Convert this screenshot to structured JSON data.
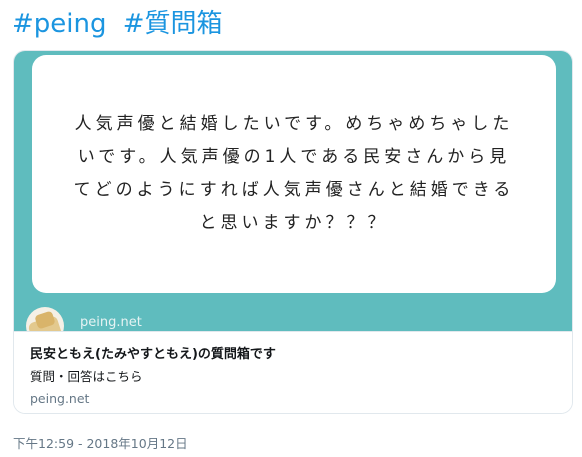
{
  "hashtags": [
    "#peing",
    "#質問箱"
  ],
  "card": {
    "question_lines": [
      "人気声優と結婚したいです。めちゃめちゃした",
      "いです。人気声優の1人である民安さんから見",
      "てどのようにすれば人気声優さんと結婚できる",
      "と思いますか？？？"
    ],
    "site_on_image": "peing.net",
    "title": "民安ともえ(たみやすともえ)の質問箱です",
    "description": "質問・回答はこちら",
    "domain": "peing.net"
  },
  "timestamp": "下午12:59 - 2018年10月12日",
  "colors": {
    "link": "#1b95e0",
    "image_bg": "#5fbcbe",
    "border": "#e1e8ed",
    "muted": "#657786"
  }
}
